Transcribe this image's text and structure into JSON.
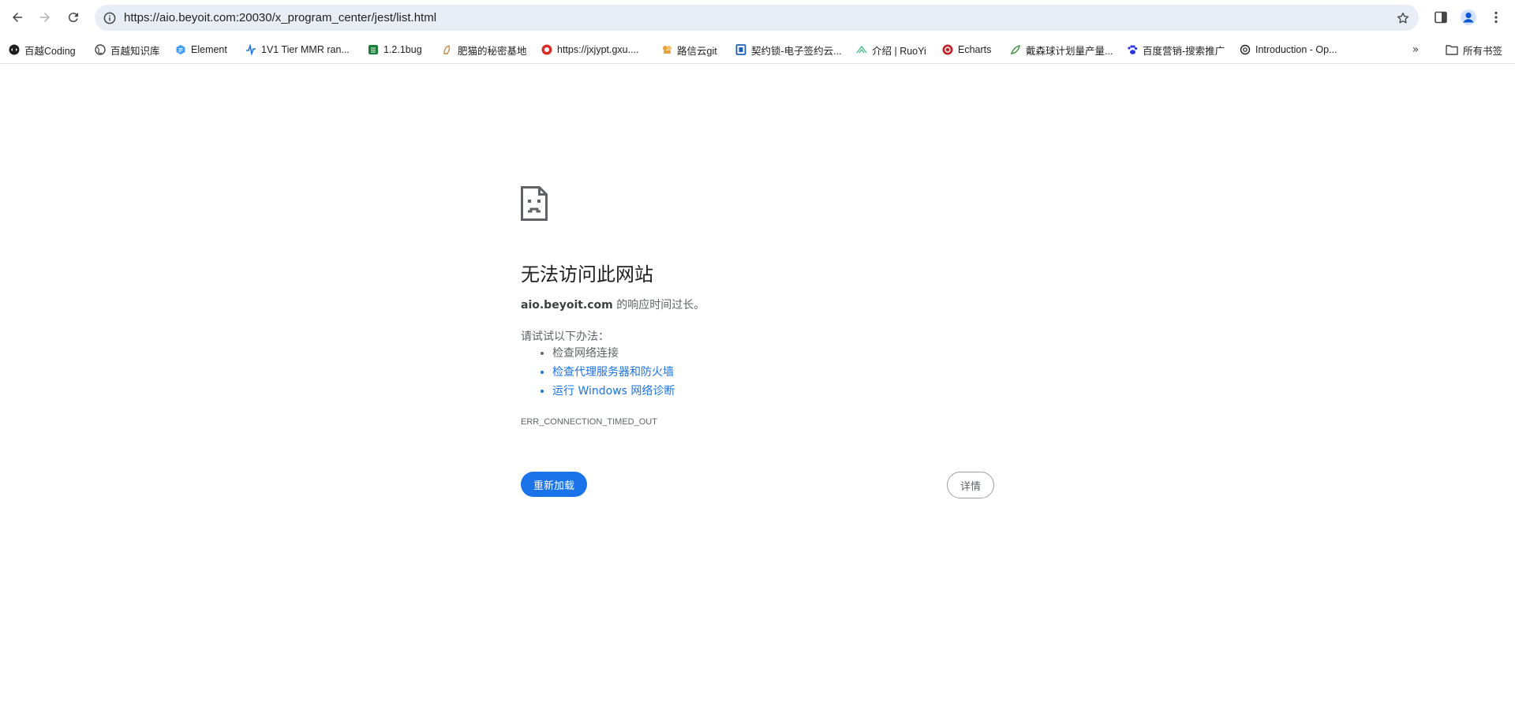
{
  "browser": {
    "url": "https://aio.beyoit.com:20030/x_program_center/jest/list.html",
    "colors": {
      "omnibox_bg": "#e9eef6",
      "accent": "#1a73e8",
      "profile": "#0b57d0"
    }
  },
  "bookmarks": {
    "items": [
      {
        "label": "百越Coding",
        "icon": "coding-icon",
        "color": "#1f1f1f"
      },
      {
        "label": "百越知识库",
        "icon": "globe-icon",
        "color": "#444746"
      },
      {
        "label": "Element",
        "icon": "element-icon",
        "color": "#409eff"
      },
      {
        "label": "1V1 Tier MMR ran...",
        "icon": "pulse-icon",
        "color": "#1a73e8"
      },
      {
        "label": "1.2.1bug",
        "icon": "sheet-icon",
        "color": "#188038"
      },
      {
        "label": "肥猫的秘密基地",
        "icon": "cat-icon",
        "color": "#c58a3e"
      },
      {
        "label": "https://jxjypt.gxu....",
        "icon": "school-icon",
        "color": "#d93025"
      },
      {
        "label": "路信云git",
        "icon": "git-icon",
        "color": "#e8a33d"
      },
      {
        "label": "契约锁-电子签约云...",
        "icon": "contract-icon",
        "color": "#1a5fb4"
      },
      {
        "label": "介绍 | RuoYi",
        "icon": "leaf-icon",
        "color": "#42b983"
      },
      {
        "label": "Echarts",
        "icon": "echarts-icon",
        "color": "#c1232b"
      },
      {
        "label": "戴森球计划量产量...",
        "icon": "dyson-icon",
        "color": "#3c8a3c"
      },
      {
        "label": "百度营销-搜索推广",
        "icon": "baidu-icon",
        "color": "#2932e1"
      },
      {
        "label": "Introduction - Op...",
        "icon": "openai-icon",
        "color": "#1f1f1f"
      }
    ],
    "more_glyph": "»",
    "all_bookmarks": "所有书签"
  },
  "error_page": {
    "title": "无法访问此网站",
    "host": "aio.beyoit.com",
    "desc_suffix": " 的响应时间过长。",
    "suggest_heading": "请试试以下办法：",
    "suggestions": [
      {
        "text": "检查网络连接",
        "link": false
      },
      {
        "text": "检查代理服务器和防火墙",
        "link": true
      },
      {
        "text": "运行 Windows 网络诊断",
        "link": true
      }
    ],
    "error_code": "ERR_CONNECTION_TIMED_OUT",
    "reload_label": "重新加载",
    "details_label": "详情"
  }
}
